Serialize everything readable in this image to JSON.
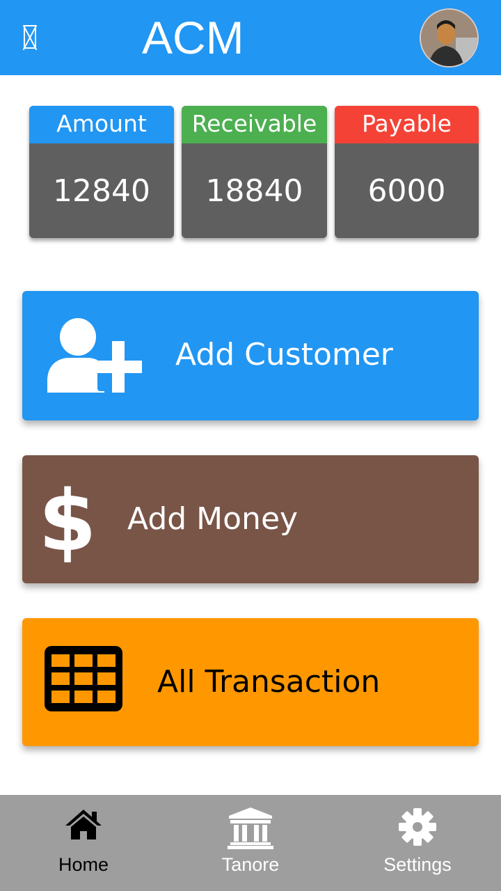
{
  "header": {
    "title": "ACM",
    "menu_icon": "menu-icon",
    "avatar_icon": "user-avatar"
  },
  "summary": [
    {
      "label": "Amount",
      "value": "12840",
      "color": "#2196f3"
    },
    {
      "label": "Receivable",
      "value": "18840",
      "color": "#4caf50"
    },
    {
      "label": "Payable",
      "value": "6000",
      "color": "#f44336"
    }
  ],
  "actions": [
    {
      "label": "Add Customer",
      "icon": "add-user-icon",
      "color": "#2196f3"
    },
    {
      "label": "Add Money",
      "icon": "dollar-icon",
      "color": "#795548"
    },
    {
      "label": "All Transaction",
      "icon": "table-icon",
      "color": "#ff9800"
    }
  ],
  "nav": [
    {
      "label": "Home",
      "icon": "home-icon",
      "active": true
    },
    {
      "label": "Tanore",
      "icon": "bank-icon",
      "active": false
    },
    {
      "label": "Settings",
      "icon": "gear-icon",
      "active": false
    }
  ]
}
